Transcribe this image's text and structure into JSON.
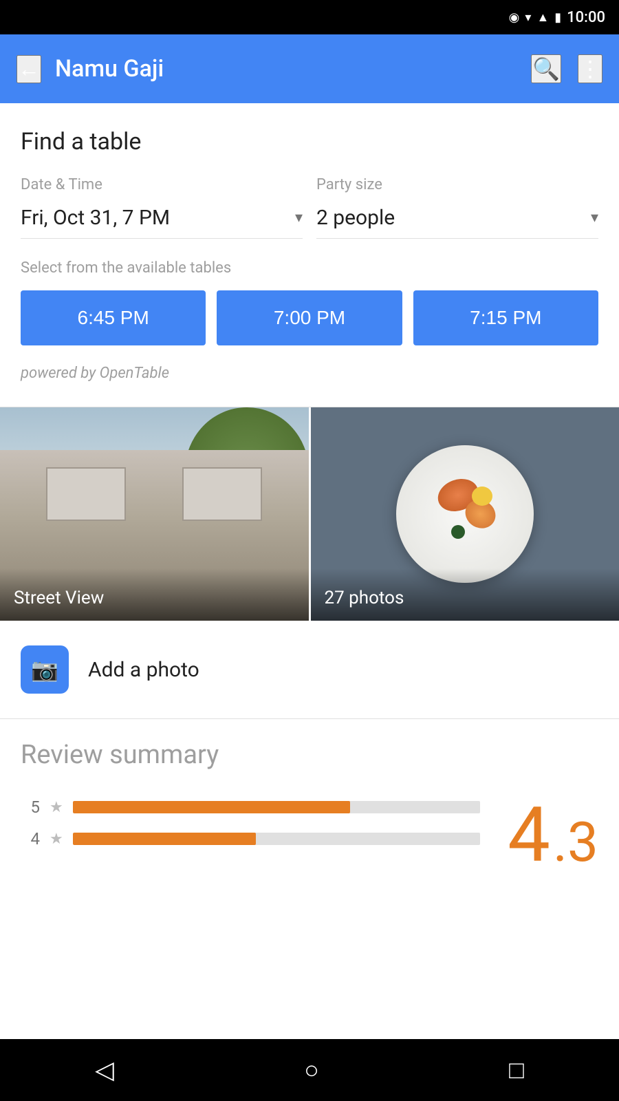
{
  "statusBar": {
    "time": "10:00",
    "icons": [
      "location-pin",
      "wifi",
      "signal",
      "battery"
    ]
  },
  "appBar": {
    "back_label": "←",
    "title": "Namu Gaji",
    "search_label": "🔍",
    "more_label": "⋮"
  },
  "findTable": {
    "section_title": "Find a table",
    "date_time_label": "Date & Time",
    "date_time_value": "Fri, Oct 31, 7 PM",
    "party_size_label": "Party size",
    "party_size_value": "2 people",
    "available_label": "Select from the available tables",
    "time_slots": [
      "6:45 PM",
      "7:00 PM",
      "7:15 PM"
    ],
    "opentable_credit": "powered by OpenTable"
  },
  "photos": {
    "street_view_label": "Street View",
    "photos_count_label": "27 photos",
    "add_photo_label": "Add a photo"
  },
  "reviewSummary": {
    "title": "Review summary",
    "rating_display": "4.3",
    "rating_int": "4",
    "rating_dec": ".3",
    "bars": [
      {
        "star": "5",
        "width_pct": 68
      },
      {
        "star": "4",
        "width_pct": 45
      }
    ]
  },
  "navBar": {
    "back_label": "◁",
    "home_label": "○",
    "recent_label": "□"
  }
}
